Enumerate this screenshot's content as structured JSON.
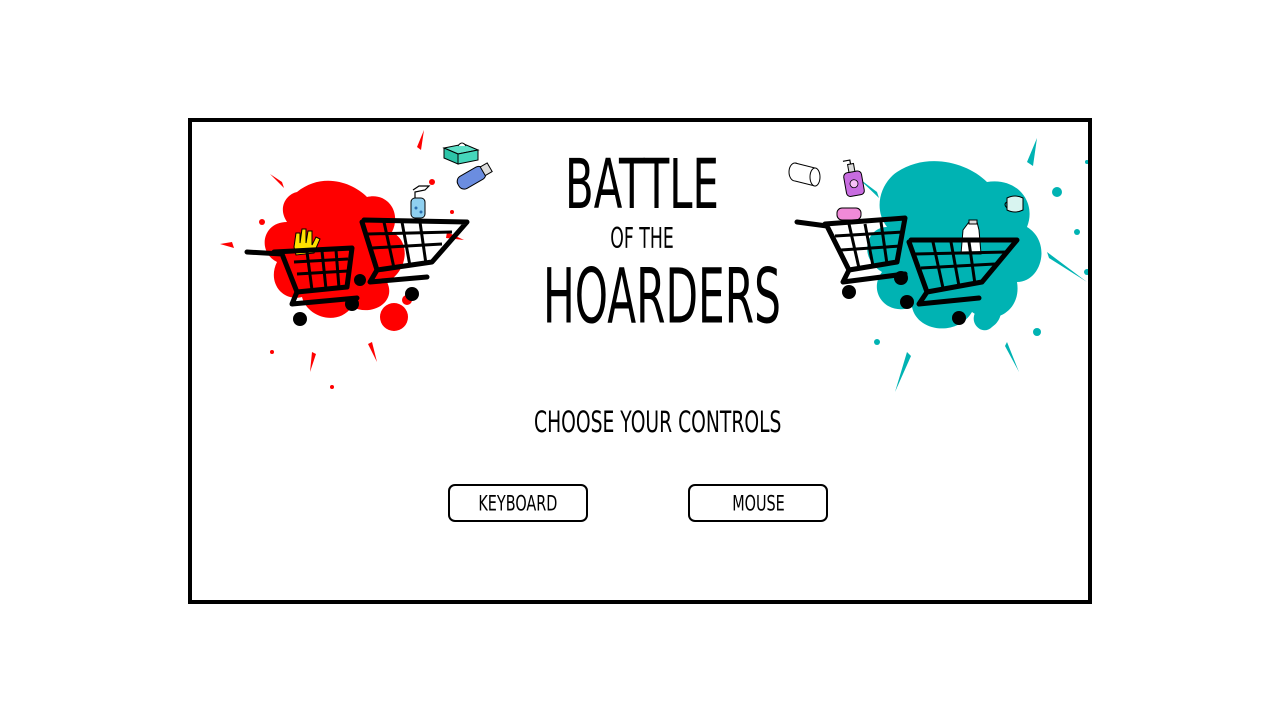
{
  "game": {
    "title_line1": "BATTLE",
    "title_line2": "OF THE",
    "title_line3": "HOARDERS",
    "prompt": "CHOOSE YOUR CONTROLS"
  },
  "buttons": {
    "keyboard_label": "KEYBOARD",
    "mouse_label": "MOUSE"
  },
  "colors": {
    "player_left": "#ff0000",
    "player_right": "#00b3b3",
    "frame": "#000000"
  },
  "icons": {
    "left_cart": "shopping-cart-icon",
    "right_cart": "shopping-cart-icon",
    "tissue_box": "tissue-box-icon",
    "spray_bottle": "spray-bottle-icon",
    "hand_sanitizer": "hand-sanitizer-icon",
    "toilet_paper": "toilet-paper-icon",
    "soap_bottle": "soap-bottle-icon",
    "face_mask": "face-mask-icon",
    "gloves": "gloves-icon",
    "bleach_bottle": "bleach-bottle-icon"
  }
}
